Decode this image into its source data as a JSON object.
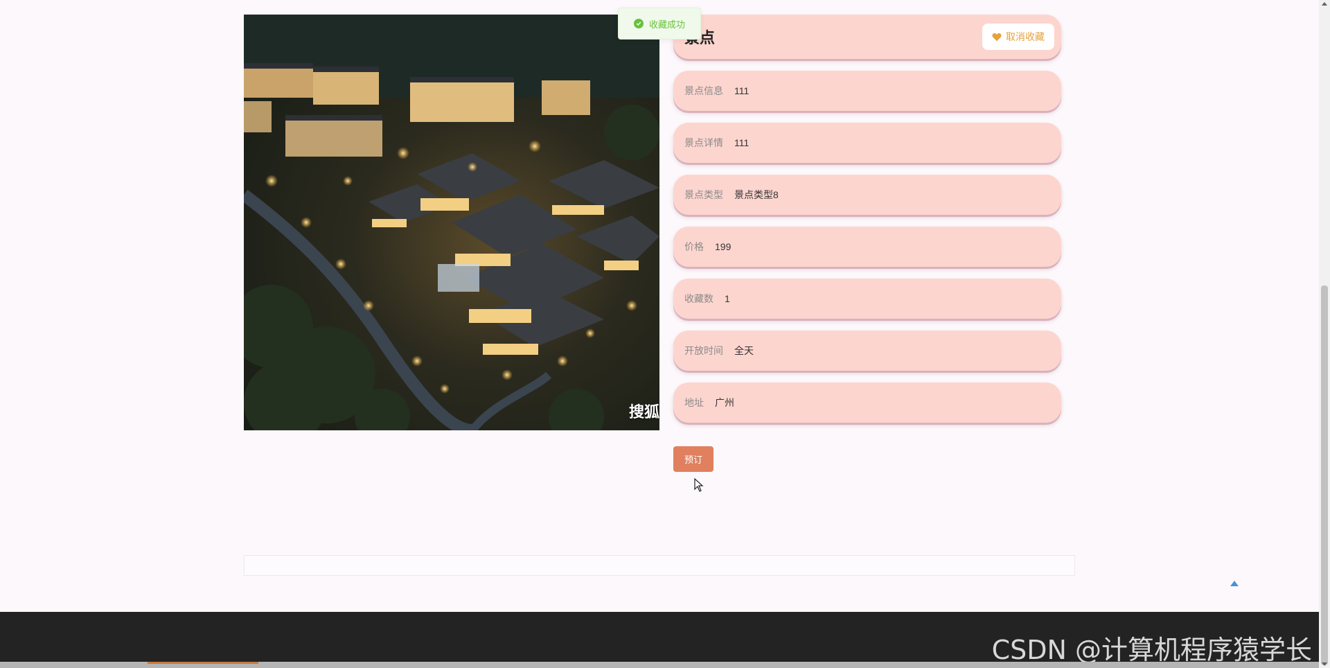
{
  "toast": {
    "text": "收藏成功",
    "icon": "check-circle-icon",
    "color": "#67c23a"
  },
  "detail": {
    "title": "景点",
    "unfavorite_label": "取消收藏",
    "unfavorite_icon": "heart-icon",
    "fields": [
      {
        "label": "景点信息",
        "value": "111"
      },
      {
        "label": "景点详情",
        "value": "111"
      },
      {
        "label": "景点类型",
        "value": "景点类型8"
      },
      {
        "label": "价格",
        "value": "199"
      },
      {
        "label": "收藏数",
        "value": "1"
      },
      {
        "label": "开放时间",
        "value": "全天"
      },
      {
        "label": "地址",
        "value": "广州"
      }
    ]
  },
  "hero": {
    "caption": "搜狐"
  },
  "actions": {
    "book_label": "预订"
  },
  "footer": {
    "watermark": "CSDN @计算机程序猿学长"
  },
  "colors": {
    "card": "#fdd5cf",
    "accent": "#e0805f",
    "favorite": "#e6a23c",
    "footer": "#232323"
  }
}
